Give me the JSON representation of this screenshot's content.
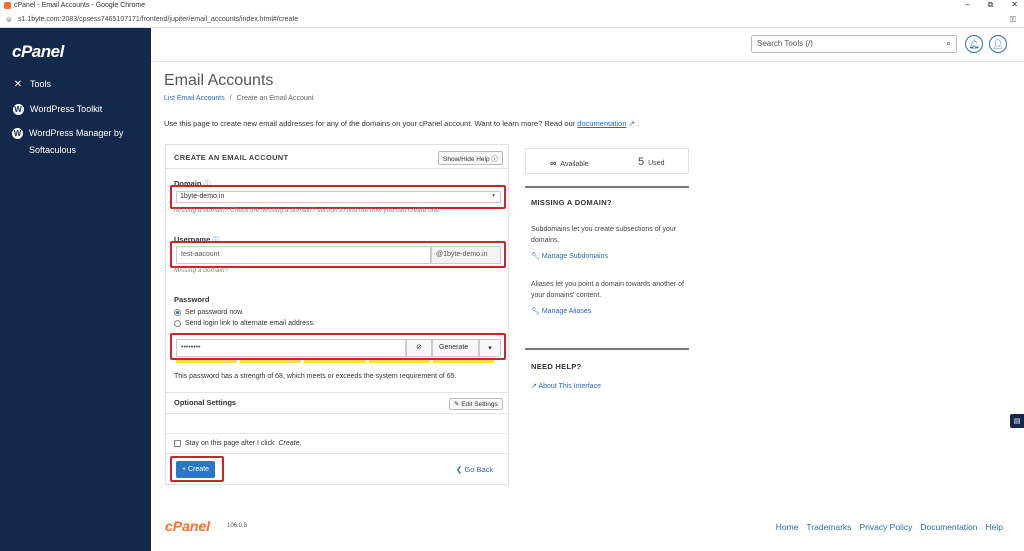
{
  "window": {
    "title": "cPanel - Email Accounts - Google Chrome",
    "url": "s1.1byte.com:2083/cpsess7465107171/frontend/jupiter/email_accounts/index.html#/create"
  },
  "sidebar": {
    "logo": "cPanel",
    "items": [
      {
        "label": "Tools",
        "icon": "tools-icon"
      },
      {
        "label": "WordPress Toolkit",
        "icon": "wordpress-icon"
      },
      {
        "label": "WordPress Manager by Softaculous",
        "icon": "wordpress-icon"
      }
    ]
  },
  "topbar": {
    "search_placeholder": "Search Tools (/)"
  },
  "page": {
    "title": "Email Accounts",
    "breadcrumb_link": "List Email Accounts",
    "breadcrumb_sep": "/",
    "breadcrumb_current": "Create an Email Account",
    "intro": "Use this page to create new email addresses for any of the domains on your cPanel account. Want to learn more? Read our",
    "intro_link": "documentation",
    "intro_end": "."
  },
  "form": {
    "heading": "CREATE AN EMAIL ACCOUNT",
    "show_hide_help": "Show/Hide Help",
    "domain_label": "Domain",
    "domain_value": "1byte-demo.in",
    "domain_hint": "Missing a domain? Check the Missing a domain? section to find out how you can create one.",
    "username_label": "Username",
    "username_value": "test-aacount",
    "username_suffix": "@1byte-demo.in",
    "username_hint": "Missing a domain?",
    "password_label": "Password",
    "radio_set": "Set password now.",
    "radio_send": "Send login link to alternate email address.",
    "password_value": "••••••••",
    "generate_label": "Generate",
    "strength_text": "This password has a strength of 68, which meets or exceeds the system requirement of 65.",
    "optional_label": "Optional Settings",
    "edit_settings": "Edit Settings",
    "stay_label": "Stay on this page after I click",
    "stay_em": "Create",
    "stay_end": ".",
    "create_label": "+ Create",
    "go_back": "Go Back"
  },
  "side": {
    "available_symbol": "∞",
    "available_label": "Available",
    "used_count": "5",
    "used_label": "Used",
    "missing_heading": "MISSING A DOMAIN?",
    "subdomains_text": "Subdomains let you create subsections of your domains.",
    "subdomains_link": "Manage Subdomains",
    "aliases_text": "Aliases let you point a domain towards another of your domains' content.",
    "aliases_link": "Manage Aliases",
    "help_heading": "NEED HELP?",
    "help_link": "About This Interface"
  },
  "footer": {
    "logo": "cPanel",
    "version": "106.0.8",
    "links": [
      "Home",
      "Trademarks",
      "Privacy Policy",
      "Documentation",
      "Help"
    ]
  },
  "colors": {
    "sidebar": "#13294b",
    "accent": "#2b6cb0",
    "brand": "#ff6c2c",
    "highlight": "#c8262b"
  }
}
